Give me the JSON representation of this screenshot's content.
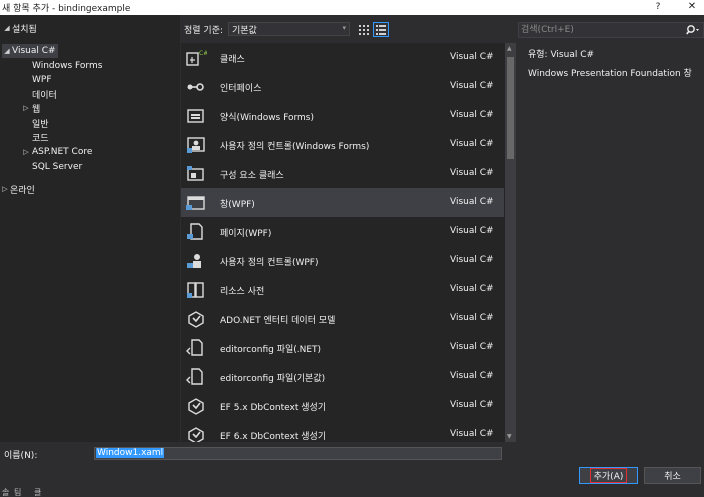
{
  "window": {
    "title": "새 항목 추가 - bindingexample",
    "help_label": "?",
    "close_label": "✕"
  },
  "tree": {
    "root_installed": "설치됨",
    "visual_csharp": "Visual C#",
    "children": [
      "Windows Forms",
      "WPF",
      "데이터",
      "웹",
      "일반",
      "코드",
      "ASP.NET Core",
      "SQL Server"
    ],
    "online": "온라인"
  },
  "toolbar": {
    "sort_label": "정렬 기준:",
    "sort_value": "기본값"
  },
  "search": {
    "placeholder": "검색(Ctrl+E)"
  },
  "items": [
    {
      "name": "클래스",
      "lang": "Visual C#",
      "icon": "class-icon"
    },
    {
      "name": "인터페이스",
      "lang": "Visual C#",
      "icon": "interface-icon"
    },
    {
      "name": "양식(Windows Forms)",
      "lang": "Visual C#",
      "icon": "form-icon"
    },
    {
      "name": "사용자 정의 컨트롤(Windows Forms)",
      "lang": "Visual C#",
      "icon": "user-control-icon"
    },
    {
      "name": "구성 요소 클래스",
      "lang": "Visual C#",
      "icon": "component-class-icon"
    },
    {
      "name": "창(WPF)",
      "lang": "Visual C#",
      "icon": "wpf-window-icon"
    },
    {
      "name": "페이지(WPF)",
      "lang": "Visual C#",
      "icon": "wpf-page-icon"
    },
    {
      "name": "사용자 정의 컨트롤(WPF)",
      "lang": "Visual C#",
      "icon": "wpf-user-control-icon"
    },
    {
      "name": "리소스 사전",
      "lang": "Visual C#",
      "icon": "resource-dictionary-icon"
    },
    {
      "name": "ADO.NET 엔터티 데이터 모델",
      "lang": "Visual C#",
      "icon": "entity-model-icon"
    },
    {
      "name": "editorconfig 파일(.NET)",
      "lang": "Visual C#",
      "icon": "editorconfig-file-icon"
    },
    {
      "name": "editorconfig 파일(기본값)",
      "lang": "Visual C#",
      "icon": "editorconfig-file-icon"
    },
    {
      "name": "EF 5.x DbContext 생성기",
      "lang": "Visual C#",
      "icon": "dbcontext-generator-icon"
    },
    {
      "name": "EF 6.x DbContext 생성기",
      "lang": "Visual C#",
      "icon": "dbcontext-generator-icon"
    }
  ],
  "detail": {
    "type_label": "유형:",
    "type_value": "Visual C#",
    "description": "Windows Presentation Foundation 창"
  },
  "name_field": {
    "label": "이름(N):",
    "value": "Window1.xaml"
  },
  "buttons": {
    "add": "추가(A)",
    "cancel": "취소"
  },
  "status_strip": [
    "솔",
    "팀",
    "클"
  ],
  "colors": {
    "background": "#2d2d30",
    "pane": "#252526",
    "selected": "#3f3f46",
    "accent": "#3399ff",
    "focus": "#e03030"
  }
}
